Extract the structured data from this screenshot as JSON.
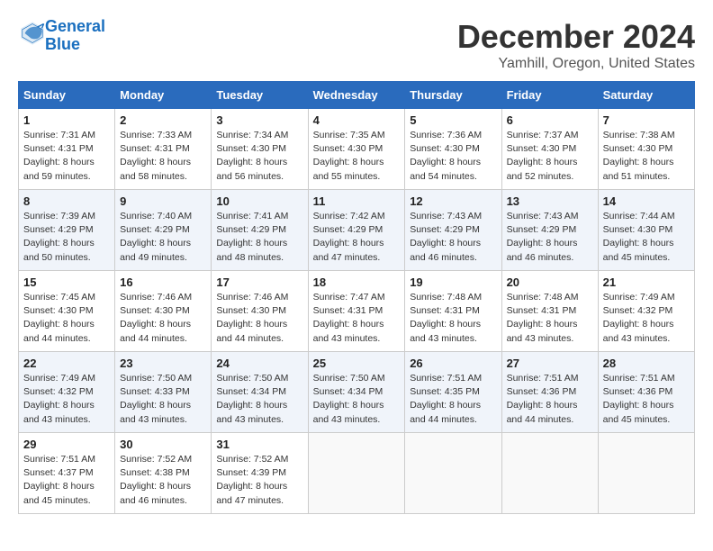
{
  "logo": {
    "line1": "General",
    "line2": "Blue"
  },
  "title": "December 2024",
  "location": "Yamhill, Oregon, United States",
  "weekdays": [
    "Sunday",
    "Monday",
    "Tuesday",
    "Wednesday",
    "Thursday",
    "Friday",
    "Saturday"
  ],
  "weeks": [
    [
      {
        "day": "1",
        "sunrise": "7:31 AM",
        "sunset": "4:31 PM",
        "daylight": "8 hours and 59 minutes."
      },
      {
        "day": "2",
        "sunrise": "7:33 AM",
        "sunset": "4:31 PM",
        "daylight": "8 hours and 58 minutes."
      },
      {
        "day": "3",
        "sunrise": "7:34 AM",
        "sunset": "4:30 PM",
        "daylight": "8 hours and 56 minutes."
      },
      {
        "day": "4",
        "sunrise": "7:35 AM",
        "sunset": "4:30 PM",
        "daylight": "8 hours and 55 minutes."
      },
      {
        "day": "5",
        "sunrise": "7:36 AM",
        "sunset": "4:30 PM",
        "daylight": "8 hours and 54 minutes."
      },
      {
        "day": "6",
        "sunrise": "7:37 AM",
        "sunset": "4:30 PM",
        "daylight": "8 hours and 52 minutes."
      },
      {
        "day": "7",
        "sunrise": "7:38 AM",
        "sunset": "4:30 PM",
        "daylight": "8 hours and 51 minutes."
      }
    ],
    [
      {
        "day": "8",
        "sunrise": "7:39 AM",
        "sunset": "4:29 PM",
        "daylight": "8 hours and 50 minutes."
      },
      {
        "day": "9",
        "sunrise": "7:40 AM",
        "sunset": "4:29 PM",
        "daylight": "8 hours and 49 minutes."
      },
      {
        "day": "10",
        "sunrise": "7:41 AM",
        "sunset": "4:29 PM",
        "daylight": "8 hours and 48 minutes."
      },
      {
        "day": "11",
        "sunrise": "7:42 AM",
        "sunset": "4:29 PM",
        "daylight": "8 hours and 47 minutes."
      },
      {
        "day": "12",
        "sunrise": "7:43 AM",
        "sunset": "4:29 PM",
        "daylight": "8 hours and 46 minutes."
      },
      {
        "day": "13",
        "sunrise": "7:43 AM",
        "sunset": "4:29 PM",
        "daylight": "8 hours and 46 minutes."
      },
      {
        "day": "14",
        "sunrise": "7:44 AM",
        "sunset": "4:30 PM",
        "daylight": "8 hours and 45 minutes."
      }
    ],
    [
      {
        "day": "15",
        "sunrise": "7:45 AM",
        "sunset": "4:30 PM",
        "daylight": "8 hours and 44 minutes."
      },
      {
        "day": "16",
        "sunrise": "7:46 AM",
        "sunset": "4:30 PM",
        "daylight": "8 hours and 44 minutes."
      },
      {
        "day": "17",
        "sunrise": "7:46 AM",
        "sunset": "4:30 PM",
        "daylight": "8 hours and 44 minutes."
      },
      {
        "day": "18",
        "sunrise": "7:47 AM",
        "sunset": "4:31 PM",
        "daylight": "8 hours and 43 minutes."
      },
      {
        "day": "19",
        "sunrise": "7:48 AM",
        "sunset": "4:31 PM",
        "daylight": "8 hours and 43 minutes."
      },
      {
        "day": "20",
        "sunrise": "7:48 AM",
        "sunset": "4:31 PM",
        "daylight": "8 hours and 43 minutes."
      },
      {
        "day": "21",
        "sunrise": "7:49 AM",
        "sunset": "4:32 PM",
        "daylight": "8 hours and 43 minutes."
      }
    ],
    [
      {
        "day": "22",
        "sunrise": "7:49 AM",
        "sunset": "4:32 PM",
        "daylight": "8 hours and 43 minutes."
      },
      {
        "day": "23",
        "sunrise": "7:50 AM",
        "sunset": "4:33 PM",
        "daylight": "8 hours and 43 minutes."
      },
      {
        "day": "24",
        "sunrise": "7:50 AM",
        "sunset": "4:34 PM",
        "daylight": "8 hours and 43 minutes."
      },
      {
        "day": "25",
        "sunrise": "7:50 AM",
        "sunset": "4:34 PM",
        "daylight": "8 hours and 43 minutes."
      },
      {
        "day": "26",
        "sunrise": "7:51 AM",
        "sunset": "4:35 PM",
        "daylight": "8 hours and 44 minutes."
      },
      {
        "day": "27",
        "sunrise": "7:51 AM",
        "sunset": "4:36 PM",
        "daylight": "8 hours and 44 minutes."
      },
      {
        "day": "28",
        "sunrise": "7:51 AM",
        "sunset": "4:36 PM",
        "daylight": "8 hours and 45 minutes."
      }
    ],
    [
      {
        "day": "29",
        "sunrise": "7:51 AM",
        "sunset": "4:37 PM",
        "daylight": "8 hours and 45 minutes."
      },
      {
        "day": "30",
        "sunrise": "7:52 AM",
        "sunset": "4:38 PM",
        "daylight": "8 hours and 46 minutes."
      },
      {
        "day": "31",
        "sunrise": "7:52 AM",
        "sunset": "4:39 PM",
        "daylight": "8 hours and 47 minutes."
      },
      null,
      null,
      null,
      null
    ]
  ]
}
